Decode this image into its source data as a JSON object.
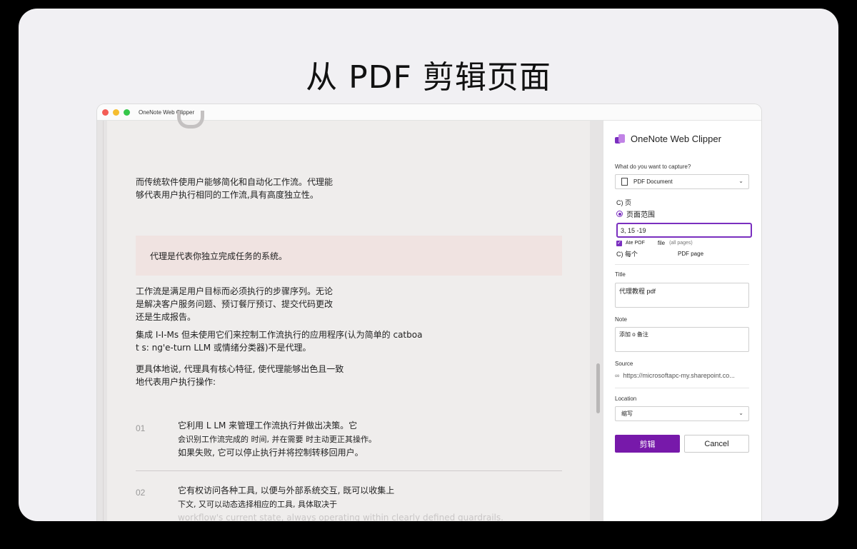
{
  "headline": "从 PDF 剪辑页面",
  "window": {
    "title": "OneNote Web Clipper"
  },
  "document": {
    "para1": [
      "而传统软件使用户能够简化和自动化工作流。代理能",
      "够代表用户执行相同的工作流,具有高度独立性。"
    ],
    "callout": "代理是代表你独立完成任务的系统。",
    "para2": [
      "工作流是满足用户目标而必须执行的步骤序列。无论",
      "是解决客户服务问题、预订餐厅预订、提交代码更改",
      "还是生成报告。"
    ],
    "para3": [
      "集成 I-I-Ms 但未使用它们来控制工作流执行的应用程序(认为简单的 catboa",
      "t s: ng'e-turn LLM 或情绪分类器)不是代理。"
    ],
    "para4": [
      "更具体地说, 代理具有核心特征, 使代理能够出色且一致",
      "地代表用户执行操作:"
    ],
    "steps": [
      {
        "num": "01",
        "lines": [
          "它利用 L LM 来管理工作流执行并做出决策。它",
          "会识别工作流完成的 时间, 并在需要 时主动更正其操作。",
          "如果失败, 它可以停止执行并将控制转移回用户。"
        ]
      },
      {
        "num": "02",
        "lines": [
          "它有权访问各种工具, 以便与外部系统交互, 既可以收集上",
          "下文, 又可以动态选择相应的工具, 具体取决于",
          "workflow's current state, always operating within clearly defined guardrails."
        ]
      }
    ]
  },
  "panel": {
    "title": "OneNote Web Clipper",
    "capture_label": "What do you want to capture?",
    "capture_value": "PDF Document",
    "option_page": "C) 页",
    "option_range": "页面范围",
    "range_value": "3, 15 -19",
    "attach_label": "Ate POF",
    "attach_file": "file",
    "attach_note": "(all pages)",
    "option_each": "C) 每个",
    "option_each_suffix": "PDF page",
    "title_label": "Title",
    "title_value": "代理教程 pdf",
    "note_label": "Note",
    "note_value": "添加 o 备注",
    "source_label": "Source",
    "source_value": "https://microsoftapc-my.sharepoint.co...",
    "location_label": "Location",
    "location_value": "缩写",
    "clip_button": "剪辑",
    "cancel_button": "Cancel"
  },
  "colors": {
    "accent": "#7719aa",
    "callout_bg": "#f0e3e1"
  }
}
